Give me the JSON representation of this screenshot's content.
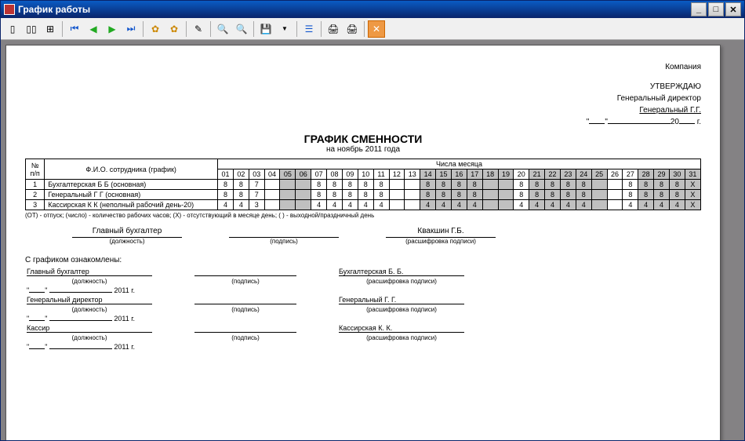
{
  "window": {
    "title": "График работы"
  },
  "header": {
    "company": "Компания",
    "approve": "УТВЕРЖДАЮ",
    "position": "Генеральный директор",
    "name": "Генеральный Г.Г.",
    "year_prefix": "20",
    "year_suffix": "г."
  },
  "doc": {
    "title": "ГРАФИК СМЕННОСТИ",
    "subtitle": "на ноябрь 2011 года"
  },
  "table": {
    "col_num": "№ п/п",
    "col_fio": "Ф.И.О. сотрудника (график)",
    "col_days": "Числа месяца",
    "days": [
      "01",
      "02",
      "03",
      "04",
      "05",
      "06",
      "07",
      "08",
      "09",
      "10",
      "11",
      "12",
      "13",
      "14",
      "15",
      "16",
      "17",
      "18",
      "19",
      "20",
      "21",
      "22",
      "23",
      "24",
      "25",
      "26",
      "27",
      "28",
      "29",
      "30",
      "31"
    ],
    "rows": [
      {
        "n": "1",
        "fio": "Бухгалтерская Б Б (основная)",
        "cells": [
          "8",
          "8",
          "7",
          "",
          "",
          "",
          "8",
          "8",
          "8",
          "8",
          "8",
          "",
          "",
          "8",
          "8",
          "8",
          "8",
          "",
          "",
          "8",
          "8",
          "8",
          "8",
          "8",
          "",
          "",
          "8",
          "8",
          "8",
          "8",
          "Х"
        ]
      },
      {
        "n": "2",
        "fio": "Генеральный Г Г (основная)",
        "cells": [
          "8",
          "8",
          "7",
          "",
          "",
          "",
          "8",
          "8",
          "8",
          "8",
          "8",
          "",
          "",
          "8",
          "8",
          "8",
          "8",
          "",
          "",
          "8",
          "8",
          "8",
          "8",
          "8",
          "",
          "",
          "8",
          "8",
          "8",
          "8",
          "Х"
        ]
      },
      {
        "n": "3",
        "fio": "Кассирская К К (неполный рабочий день-20)",
        "cells": [
          "4",
          "4",
          "3",
          "",
          "",
          "",
          "4",
          "4",
          "4",
          "4",
          "4",
          "",
          "",
          "4",
          "4",
          "4",
          "4",
          "",
          "",
          "4",
          "4",
          "4",
          "4",
          "4",
          "",
          "",
          "4",
          "4",
          "4",
          "4",
          "Х"
        ]
      }
    ]
  },
  "shaded_days": [
    "05",
    "06",
    "14",
    "15",
    "16",
    "17",
    "18",
    "19",
    "21",
    "22",
    "23",
    "24",
    "25",
    "28",
    "29",
    "30",
    "31"
  ],
  "legend": "(ОТ) - отпуск; (число) - количество рабочих часов; (Х) - отсутствующий в месяце день; ( ) - выходной/праздничный день",
  "sig": {
    "position": "Главный бухгалтер",
    "pos_cap": "(должность)",
    "sign_cap": "(подпись)",
    "name": "Квакшин Г.Б.",
    "name_cap": "(расшифровка подписи)"
  },
  "ack": {
    "title": "С графиком ознакомлены:",
    "year_label": "2011 г.",
    "rows": [
      {
        "position": "Главный бухгалтер",
        "name": "Бухгалтерская Б. Б."
      },
      {
        "position": "Генеральный директор",
        "name": "Генеральный Г. Г."
      },
      {
        "position": "Кассир",
        "name": "Кассирская К. К."
      }
    ],
    "pos_cap": "(должность)",
    "sign_cap": "(подпись)",
    "name_cap": "(расшифровка подписи)"
  }
}
